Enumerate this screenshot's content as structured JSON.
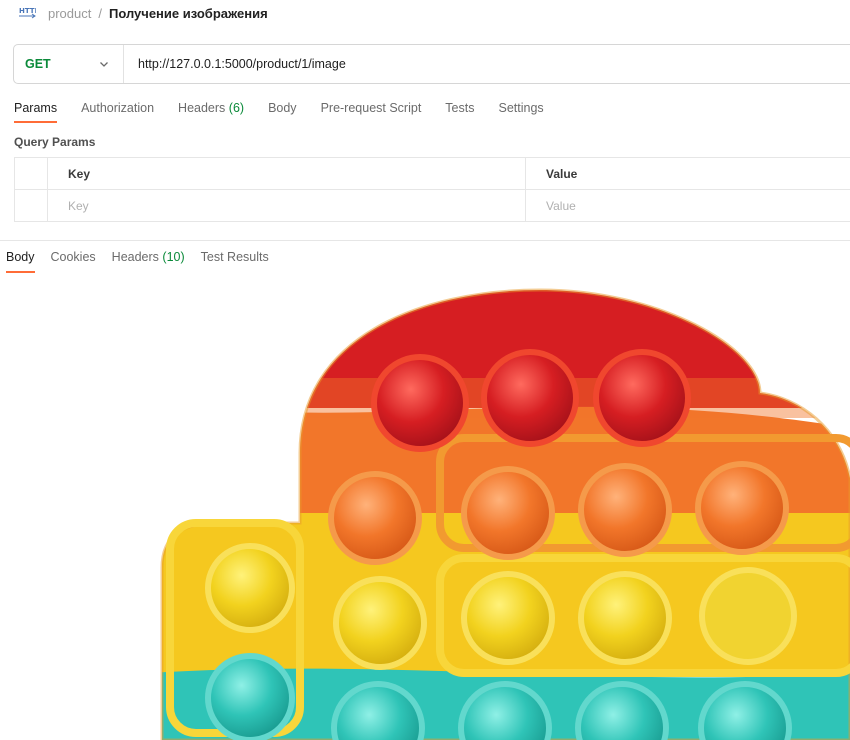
{
  "breadcrumb": {
    "root": "product",
    "separator": "/",
    "current": "Получение изображения"
  },
  "request": {
    "method": "GET",
    "url": "http://127.0.0.1:5000/product/1/image"
  },
  "request_tabs": [
    {
      "label": "Params",
      "count": ""
    },
    {
      "label": "Authorization",
      "count": ""
    },
    {
      "label": "Headers",
      "count": "(6)"
    },
    {
      "label": "Body",
      "count": ""
    },
    {
      "label": "Pre-request Script",
      "count": ""
    },
    {
      "label": "Tests",
      "count": ""
    },
    {
      "label": "Settings",
      "count": ""
    }
  ],
  "query_params": {
    "title": "Query Params",
    "key_header": "Key",
    "value_header": "Value",
    "key_placeholder": "Key",
    "value_placeholder": "Value"
  },
  "response_tabs": [
    {
      "label": "Body",
      "count": ""
    },
    {
      "label": "Cookies",
      "count": ""
    },
    {
      "label": "Headers",
      "count": "(10)"
    },
    {
      "label": "Test Results",
      "count": ""
    }
  ],
  "response_image": {
    "subject": "rainbow pop-it fidget toy",
    "colors": [
      "#d61e22",
      "#f2762a",
      "#f7d21e",
      "#2fc4b7"
    ]
  },
  "colors": {
    "accent": "#ff6c37",
    "method_get": "#0b8a3a",
    "count": "#0b8a3a"
  },
  "icons": {
    "http": "http-icon",
    "chevron": "chevron-down-icon"
  }
}
